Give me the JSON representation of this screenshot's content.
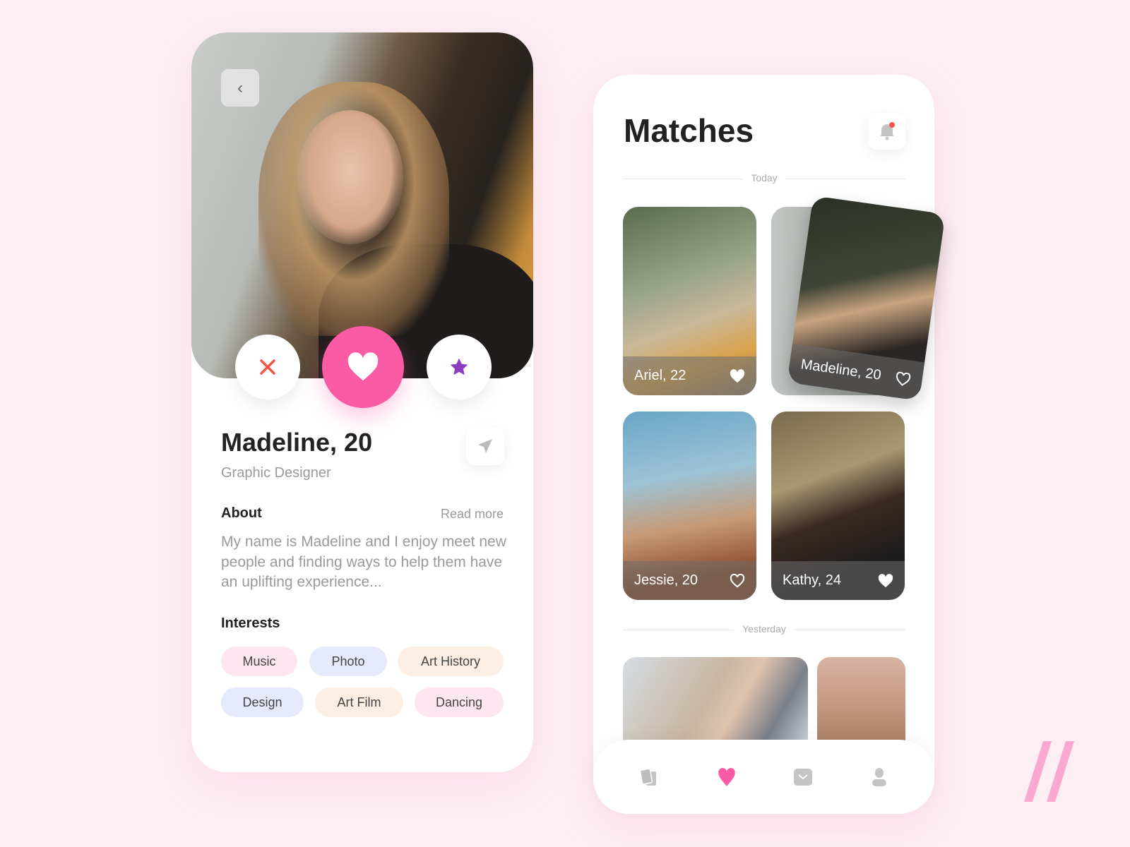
{
  "profile": {
    "name": "Madeline, 20",
    "role": "Graphic Designer",
    "about_heading": "About",
    "read_more": "Read more",
    "about_text": "My name is Madeline and I enjoy meet new people and finding ways to help them have an uplifting experience...",
    "interests_heading": "Interests",
    "interests": [
      {
        "label": "Music",
        "color": "#fde6f0"
      },
      {
        "label": "Photo",
        "color": "#e6e9fb"
      },
      {
        "label": "Art History",
        "color": "#fdeee3"
      },
      {
        "label": "Design",
        "color": "#e6e9fb"
      },
      {
        "label": "Art Film",
        "color": "#fdeee3"
      },
      {
        "label": "Dancing",
        "color": "#fde6f0"
      }
    ],
    "actions": {
      "dislike_icon": "close-icon",
      "like_icon": "heart-icon",
      "superlike_icon": "star-icon"
    }
  },
  "matches": {
    "title": "Matches",
    "today_label": "Today",
    "yesterday_label": "Yesterday",
    "today": [
      {
        "label": "Ariel, 22",
        "liked": true
      },
      {
        "label": "Madeline, 20",
        "liked": false
      },
      {
        "label": "Jessie, 20",
        "liked": false
      },
      {
        "label": "Kathy, 24",
        "liked": true
      }
    ]
  },
  "nav": {
    "items": [
      "cards-icon",
      "heart-icon",
      "mail-icon",
      "profile-icon"
    ],
    "active": "heart-icon"
  },
  "colors": {
    "accent": "#fb5ba4",
    "dislike": "#f4554a",
    "star": "#8b3ec0",
    "background": "#fdeef4",
    "brand_slashes": "#f9a8cf"
  }
}
